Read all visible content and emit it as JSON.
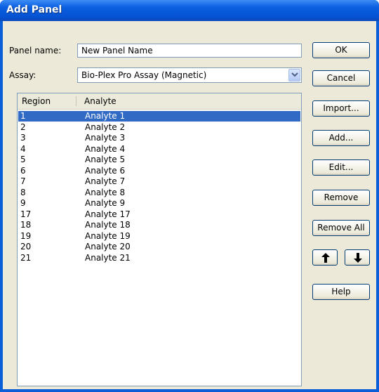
{
  "window": {
    "title": "Add Panel"
  },
  "form": {
    "panel_name_label": "Panel name:",
    "panel_name_value": "New Panel Name",
    "assay_label": "Assay:",
    "assay_value": "Bio-Plex Pro Assay (Magnetic)"
  },
  "list": {
    "columns": [
      "Region",
      "Analyte"
    ],
    "rows": [
      {
        "region": "1",
        "analyte": "Analyte 1",
        "selected": true
      },
      {
        "region": "2",
        "analyte": "Analyte 2"
      },
      {
        "region": "3",
        "analyte": "Analyte 3"
      },
      {
        "region": "4",
        "analyte": "Analyte 4"
      },
      {
        "region": "5",
        "analyte": "Analyte 5"
      },
      {
        "region": "6",
        "analyte": "Analyte 6"
      },
      {
        "region": "7",
        "analyte": "Analyte 7"
      },
      {
        "region": "8",
        "analyte": "Analyte 8"
      },
      {
        "region": "9",
        "analyte": "Analyte 9"
      },
      {
        "region": "17",
        "analyte": "Analyte 17"
      },
      {
        "region": "18",
        "analyte": "Analyte 18"
      },
      {
        "region": "19",
        "analyte": "Analyte 19"
      },
      {
        "region": "20",
        "analyte": "Analyte 20"
      },
      {
        "region": "21",
        "analyte": "Analyte 21"
      }
    ]
  },
  "buttons": {
    "ok": "OK",
    "cancel": "Cancel",
    "import": "Import...",
    "add": "Add...",
    "edit": "Edit...",
    "remove": "Remove",
    "remove_all": "Remove All",
    "help": "Help"
  },
  "icons": {
    "move_up": "arrow-up-icon",
    "move_down": "arrow-down-icon",
    "dropdown": "chevron-down-icon"
  },
  "colors": {
    "titlebar": "#0553d2",
    "dialog_bg": "#ece9d8",
    "selection": "#316ac5"
  }
}
